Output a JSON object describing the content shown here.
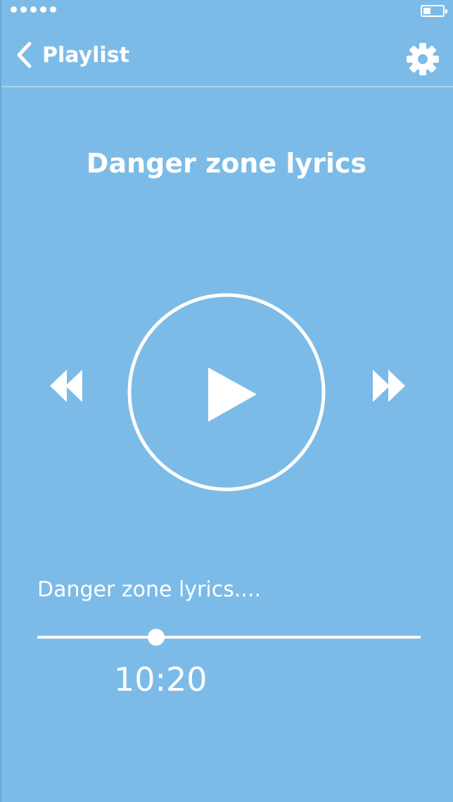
{
  "status_bar": {
    "signal_icon": "signal-dots-icon",
    "battery_icon": "battery-icon",
    "battery_level": 0.4
  },
  "nav": {
    "back_label": "Playlist",
    "back_icon": "chevron-left-icon",
    "settings_icon": "gear-icon"
  },
  "player": {
    "title": "Danger zone lyrics",
    "rewind_icon": "rewind-icon",
    "play_icon": "play-icon",
    "forward_icon": "fast-forward-icon"
  },
  "lyrics": {
    "text": "Danger zone lyrics...."
  },
  "progress": {
    "fraction": 0.31,
    "time": "10:20"
  },
  "colors": {
    "background": "#7cbbe7",
    "foreground": "#ffffff",
    "divider": "#a9d3f1"
  }
}
